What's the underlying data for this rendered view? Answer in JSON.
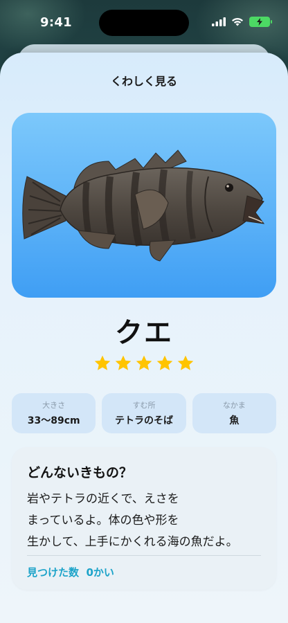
{
  "status_bar": {
    "time": "9:41",
    "battery_color": "#4cd964"
  },
  "sheet": {
    "title": "くわしく見る"
  },
  "creature": {
    "name": "クエ",
    "rating": 5,
    "rating_max": 5,
    "star_color": "#ffc400",
    "info": [
      {
        "label": "大きさ",
        "value": "33〜89cm"
      },
      {
        "label": "すむ所",
        "value": "テトラのそば"
      },
      {
        "label": "なかま",
        "value": "魚"
      }
    ]
  },
  "description": {
    "title": "どんないきもの？",
    "lines": [
      "岩やテトラの近くで、えさを",
      "まっているよ。体の色や形を",
      "生かして、上手にかくれる海の魚だよ。"
    ],
    "found_label": "見つけた数",
    "found_value": "0かい",
    "accent_color": "#1ca3c9"
  }
}
